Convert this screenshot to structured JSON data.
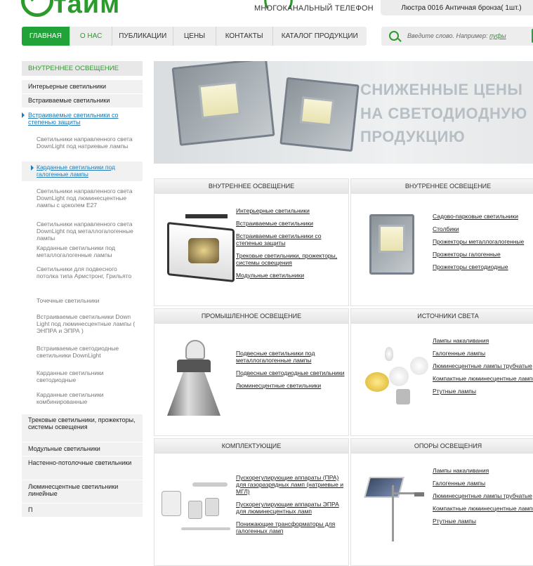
{
  "header": {
    "logo_text": "тайм",
    "phone_label": "МНОГОКАНАЛЬНЫЙ ТЕЛЕФОН",
    "cart_text": "Люстра 0016 Античная бронза( 1шт.)"
  },
  "nav": [
    {
      "label": "ГЛАВНАЯ"
    },
    {
      "label": "О НАС"
    },
    {
      "label": "ПУБЛИКАЦИИ"
    },
    {
      "label": "ЦЕНЫ"
    },
    {
      "label": "КОНТАКТЫ"
    },
    {
      "label": "КАТАЛОГ ПРОДУКЦИИ"
    }
  ],
  "search": {
    "placeholder_prefix": "Введите слово. Например: ",
    "placeholder_example": "пуфы"
  },
  "sidebar": {
    "heading": "ВНУТРЕННЕЕ ОСВЕЩЕНИЕ",
    "items": [
      "Интерьерные светильники",
      "Встраиваемые светильники",
      "Встраиваемые светильники со степенью защиты",
      "Светильники направленного света DownLight под натриевые лампы",
      "Карданные светильники под галогенные лампы",
      "Светильники направленного света DownLight под люминесцентные лампы с цоколем Е27",
      "Светильники направленного света DownLight под металлогалогенные лампы",
      "Карданные светильники под металлогалогенные лампы",
      "Светильники для подвесного потолка типа Армстронг, Грильято",
      "Точечные светильники",
      "Встраиваемые светильники Down Light под люминесцентные лампы ( ЭНПРА и ЭПРА )",
      "Встраиваемые светодиодные светильники DownLight",
      "Карданные светильники светодиодные",
      "Карданные светильники комбинированные",
      "Трековые светильники, прожекторы, системы освещения",
      "Модульные светильники",
      "Настенно-потолочные светильники",
      "Люминесцентные светильники линейные",
      "П"
    ]
  },
  "banner": {
    "line1": "СНИЖЕННЫЕ ЦЕНЫ",
    "line2": "НА СВЕТОДИОДНУЮ",
    "line3": "ПРОДУКЦИЮ"
  },
  "panels": [
    {
      "title": "ВНУТРЕННЕЕ ОСВЕЩЕНИЕ",
      "links": [
        "Интерьерные светильники",
        "Встраиваемые светильники",
        "Встраиваемые светильники со степенью защиты",
        "Трековые светильники, прожекторы, системы освещения",
        "Модульные светильники"
      ]
    },
    {
      "title": "ВНУТРЕННЕЕ ОСВЕЩЕНИЕ",
      "links": [
        "Садово-парковые светильники",
        "Столбики",
        "Прожекторы металлогалогенные",
        "Прожекторы галогенные",
        "Прожекторы светодиодные"
      ]
    },
    {
      "title": "ПРОМЫШЛЕННОЕ ОСВЕЩЕНИЕ",
      "links": [
        "Подвесные светильники под металлогалогенные лампы",
        "Подвесные светодиодные светильники",
        "Люминесцентные светильники"
      ]
    },
    {
      "title": "ИСТОЧНИКИ СВЕТА",
      "links": [
        "Лампы накаливания",
        "Галогенные лампы",
        "Люминесцентные лампы трубчатые",
        "Компактные люминесцентные лампы",
        "Ртутные лампы"
      ]
    },
    {
      "title": "КОМПЛЕКТУЮЩИЕ",
      "links": [
        "Пускорегулирующие аппараты (ПРА) для газоразрядных ламп (натриевые и МГЛ)",
        "Пускорегулирующие аппараты ЭПРА для люминесцентных ламп",
        "Понижающие трансформаторы для галогенных ламп"
      ]
    },
    {
      "title": "ОПОРЫ ОСВЕЩЕНИЯ",
      "links": [
        "Лампы накаливания",
        "Галогенные лампы",
        "Люминесцентные лампы трубчатые",
        "Компактные люминесцентные лампы",
        "Ртутные лампы"
      ]
    }
  ]
}
